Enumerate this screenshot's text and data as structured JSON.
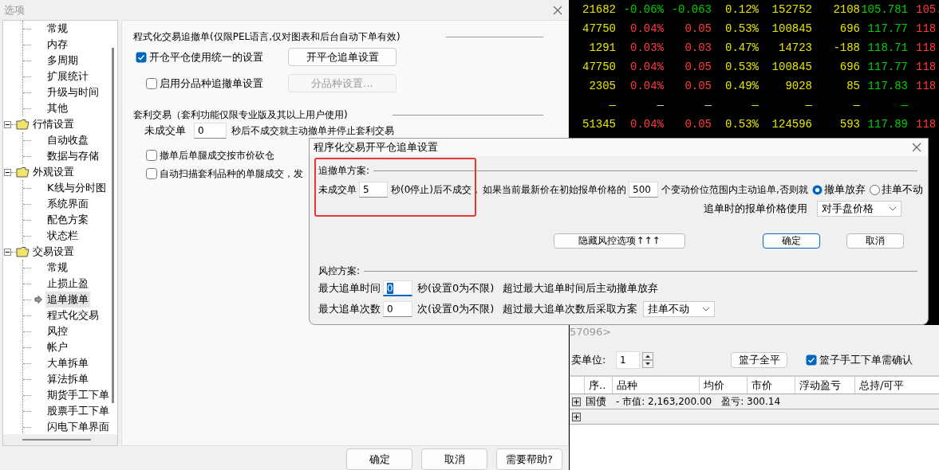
{
  "options_window": {
    "title": "选项",
    "tree": [
      {
        "children": [
          {
            "label": "常规",
            "selected": false
          },
          {
            "label": "内存",
            "selected": false
          },
          {
            "label": "多周期",
            "selected": false
          },
          {
            "label": "扩展统计",
            "selected": false
          },
          {
            "label": "升级与时间",
            "selected": false
          },
          {
            "label": "其他",
            "selected": false
          }
        ]
      },
      {
        "label": "行情设置",
        "expanded": true,
        "children": [
          {
            "label": "自动收盘",
            "selected": false
          },
          {
            "label": "数据与存储",
            "selected": false
          }
        ]
      },
      {
        "label": "外观设置",
        "expanded": true,
        "children": [
          {
            "label": "K线与分时图",
            "selected": false
          },
          {
            "label": "系统界面",
            "selected": false
          },
          {
            "label": "配色方案",
            "selected": false
          },
          {
            "label": "状态栏",
            "selected": false
          }
        ]
      },
      {
        "label": "交易设置",
        "expanded": true,
        "children": [
          {
            "label": "常规",
            "selected": false
          },
          {
            "label": "止损止盈",
            "selected": false
          },
          {
            "label": "追单撤单",
            "selected": true
          },
          {
            "label": "程式化交易",
            "selected": false
          },
          {
            "label": "风控",
            "selected": false
          },
          {
            "label": "帐户",
            "selected": false
          },
          {
            "label": "大单拆单",
            "selected": false
          },
          {
            "label": "算法拆单",
            "selected": false
          },
          {
            "label": "期货手工下单",
            "selected": false
          },
          {
            "label": "股票手工下单",
            "selected": false
          },
          {
            "label": "闪电下单界面",
            "selected": false
          }
        ]
      }
    ],
    "program_section": {
      "title": "程式化交易追撤单(仅限PEL语言,仅对图表和后台自动下单有效)",
      "options": [
        {
          "label": "开仓平仓使用统一的设置",
          "checked": true,
          "button": "开平仓追单设置",
          "button_disabled": false
        },
        {
          "label": "启用分品种追撤单设置",
          "checked": false,
          "button": "分品种设置...",
          "button_disabled": true
        }
      ]
    },
    "arbitrage_section": {
      "title": "套利交易（套利功能仅限专业版及其以上用户使用)",
      "unfilled_label": "未成交单",
      "unfilled_value": "0",
      "unfilled_suffix": "秒后不成交就主动撤单并停止套利交易",
      "options": [
        {
          "label": "撤单后单腿成交按市价砍仓",
          "checked": false
        },
        {
          "label": "自动扫描套利品种的单腿成交，发",
          "checked": false
        }
      ]
    },
    "buttons": [
      "确定",
      "取消",
      "需要帮助?"
    ]
  },
  "quote_board": {
    "rows": [
      {
        "cells": [
          {
            "text": "21682",
            "color": "#e6e600"
          },
          {
            "text": "-0.06%",
            "color": "#00d000"
          },
          {
            "text": "-0.063",
            "color": "#00d000"
          },
          {
            "text": "0.12%",
            "color": "#e6e600"
          },
          {
            "text": "152752",
            "color": "#e6e600"
          },
          {
            "text": "2108",
            "color": "#e6e600"
          },
          {
            "text": "105.781",
            "color": "#00d000"
          },
          {
            "text": "105.",
            "color": "#ff3b3b"
          }
        ]
      },
      {
        "cells": [
          {
            "text": "47750",
            "color": "#e6e600"
          },
          {
            "text": "0.04%",
            "color": "#ff3b3b"
          },
          {
            "text": "0.05",
            "color": "#ff3b3b"
          },
          {
            "text": "0.53%",
            "color": "#e6e600"
          },
          {
            "text": "100845",
            "color": "#e6e600"
          },
          {
            "text": "696",
            "color": "#e6e600"
          },
          {
            "text": "117.77",
            "color": "#00d000"
          },
          {
            "text": "118",
            "color": "#ff3b3b"
          }
        ]
      },
      {
        "cells": [
          {
            "text": "1291",
            "color": "#e6e600"
          },
          {
            "text": "0.03%",
            "color": "#ff3b3b"
          },
          {
            "text": "0.03",
            "color": "#ff3b3b"
          },
          {
            "text": "0.47%",
            "color": "#e6e600"
          },
          {
            "text": "14723",
            "color": "#e6e600"
          },
          {
            "text": "-188",
            "color": "#e6e600"
          },
          {
            "text": "118.71",
            "color": "#00d000"
          },
          {
            "text": "118",
            "color": "#ff3b3b"
          }
        ]
      },
      {
        "cells": [
          {
            "text": "47750",
            "color": "#e6e600"
          },
          {
            "text": "0.04%",
            "color": "#ff3b3b"
          },
          {
            "text": "0.05",
            "color": "#ff3b3b"
          },
          {
            "text": "0.53%",
            "color": "#e6e600"
          },
          {
            "text": "100845",
            "color": "#e6e600"
          },
          {
            "text": "696",
            "color": "#e6e600"
          },
          {
            "text": "117.77",
            "color": "#00d000"
          },
          {
            "text": "118",
            "color": "#ff3b3b"
          }
        ]
      },
      {
        "cells": [
          {
            "text": "2305",
            "color": "#e6e600"
          },
          {
            "text": "0.04%",
            "color": "#ff3b3b"
          },
          {
            "text": "0.05",
            "color": "#ff3b3b"
          },
          {
            "text": "0.49%",
            "color": "#e6e600"
          },
          {
            "text": "9028",
            "color": "#e6e600"
          },
          {
            "text": "85",
            "color": "#e6e600"
          },
          {
            "text": "117.83",
            "color": "#00d000"
          },
          {
            "text": "118",
            "color": "#ff3b3b"
          }
        ]
      },
      {
        "cells": [
          {
            "text": "—",
            "color": "#e6e600"
          },
          {
            "text": "—",
            "color": "#d0d0d0"
          },
          {
            "text": "—",
            "color": "#d0d0d0"
          },
          {
            "text": "—",
            "color": "#e6e600"
          },
          {
            "text": "—",
            "color": "#e6e600"
          },
          {
            "text": "—",
            "color": "#e6e600"
          },
          {
            "text": "—",
            "color": "#00d000"
          }
        ]
      },
      {
        "cells": [
          {
            "text": "51345",
            "color": "#e6e600"
          },
          {
            "text": "0.04%",
            "color": "#ff3b3b"
          },
          {
            "text": "0.05",
            "color": "#ff3b3b"
          },
          {
            "text": "0.53%",
            "color": "#e6e600"
          },
          {
            "text": "124596",
            "color": "#e6e600"
          },
          {
            "text": "593",
            "color": "#e6e600"
          },
          {
            "text": "117.89",
            "color": "#00d000"
          },
          {
            "text": "118",
            "color": "#ff3b3b"
          }
        ]
      }
    ]
  },
  "trade_panel": {
    "account_tail": "57096>",
    "unit_label": "卖单位:",
    "unit_value": "1",
    "flatten_button": "篮子全平",
    "confirm": {
      "label": "篮子手工下单需确认",
      "checked": true
    },
    "table": {
      "columns": [
        "序..",
        "品种",
        "均价",
        "市价",
        "浮动盈亏",
        "总持/可平"
      ],
      "rows": [
        {
          "expanded": false,
          "name": "国债",
          "market_value": "- 市值: 2,163,200.00",
          "profit": "盈亏: 300.14"
        },
        {
          "expanded": false
        }
      ]
    }
  },
  "dialog": {
    "title": "程序化交易开平仓追单设置",
    "chase_section": {
      "title": "追撤单方案:",
      "unfilled_label": "未成交单",
      "unfilled_value": "5",
      "text_1": "秒(0停止)后不成交，",
      "text_2": "如果当前最新价在初始报单价格的",
      "ticks_value": "500",
      "text_3": "个变动价位范围内主动追单,否则就",
      "choices": [
        {
          "label": "撤单放弃",
          "selected": true
        },
        {
          "label": "挂单不动",
          "selected": false
        }
      ],
      "price_label": "追单时的报单价格使用",
      "price_value": "对手盘价格"
    },
    "toggle_button": "隐藏风控选项↑↑↑",
    "buttons": [
      {
        "label": "确定",
        "default": true
      },
      {
        "label": "取消",
        "default": false
      }
    ],
    "risk_section": {
      "title": "风控方案:",
      "rows": [
        {
          "label": "最大追单时间",
          "value": "0",
          "focused": true,
          "unit": "秒(设置0为不限)",
          "note": "超过最大追单时间后主动撤单放弃"
        },
        {
          "label": "最大追单次数",
          "value": "0",
          "focused": false,
          "unit": "次(设置0为不限)",
          "note": "超过最大追单次数后采取方案",
          "select": "挂单不动"
        }
      ]
    }
  }
}
